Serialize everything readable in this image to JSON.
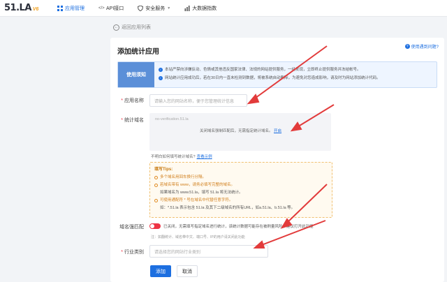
{
  "topnav": {
    "logo_main": "51.LA",
    "logo_version": "V6",
    "items": [
      {
        "label": "应用管理",
        "icon": "grid-icon",
        "active": true
      },
      {
        "label": "API接口",
        "icon": "code-icon",
        "active": false
      },
      {
        "label": "安全服务",
        "icon": "shield-icon",
        "active": false,
        "has_dropdown": true
      },
      {
        "label": "大数据指数",
        "icon": "chart-icon",
        "active": false
      }
    ]
  },
  "back_link": "返回应用列表",
  "page_title": "添加统计应用",
  "help_link": "使用遇到问题?",
  "notice": {
    "tag": "使用须知",
    "lines": [
      "本站严禁向涉嫌反动、色情或其他违反国家法律、法规的网站提供服务，一经发现，立即终止提供服务并冻结帐号。",
      "网站统计应用成功后，若在30日内一直未检测到数据，将被系统自动删除，为避免对您造成影响，请及时为网站添加统计代码。"
    ]
  },
  "form": {
    "app_name_label": "应用名称",
    "app_name_placeholder": "请输入您的网站名称，便于您管理统计信息",
    "domain_label": "统计域名",
    "domain_placeholder": "no-verification.51.la",
    "domain_msg": "关闭域名强制匹配后，无需指定统计域名。",
    "domain_msg_link": "开启",
    "hint_text": "不明白如何填写统计域名?",
    "hint_link": "查看示例",
    "tips_title": "填写Tips:",
    "tips": [
      {
        "text": "多个域名用回车换行分隔。",
        "style": "warn"
      },
      {
        "text": "若域名带有 www，请务必填写完整的域名。",
        "style": "warn"
      },
      {
        "text": "如果域名为 www.51.la，填写 51.la 将无法统计。",
        "style": "plain"
      },
      {
        "text": "可使用通配符 * 号在域名中代替任意字符。",
        "style": "warn"
      },
      {
        "text": "如：*.51.la 表示包含 51.la 及其下二级域名的所有URL，如a.51.la、b.51.la 等。",
        "style": "plain"
      }
    ],
    "match_label": "域名强匹配",
    "match_text": "已关闭，无需填写指定域名进行统计，该统计数据可能存在被刷量风险，建议打开此功能",
    "match_note": "注：如翻统计、域名带中文、端口号、IP的用户请关闭此功能",
    "industry_label": "行业类别",
    "industry_placeholder": "请选择您的网站行业类别",
    "submit_label": "添加",
    "cancel_label": "取消"
  },
  "colors": {
    "accent": "#1d6fe0",
    "annotation_arrow": "#e23b3b",
    "toggle_off": "#ee3344"
  }
}
